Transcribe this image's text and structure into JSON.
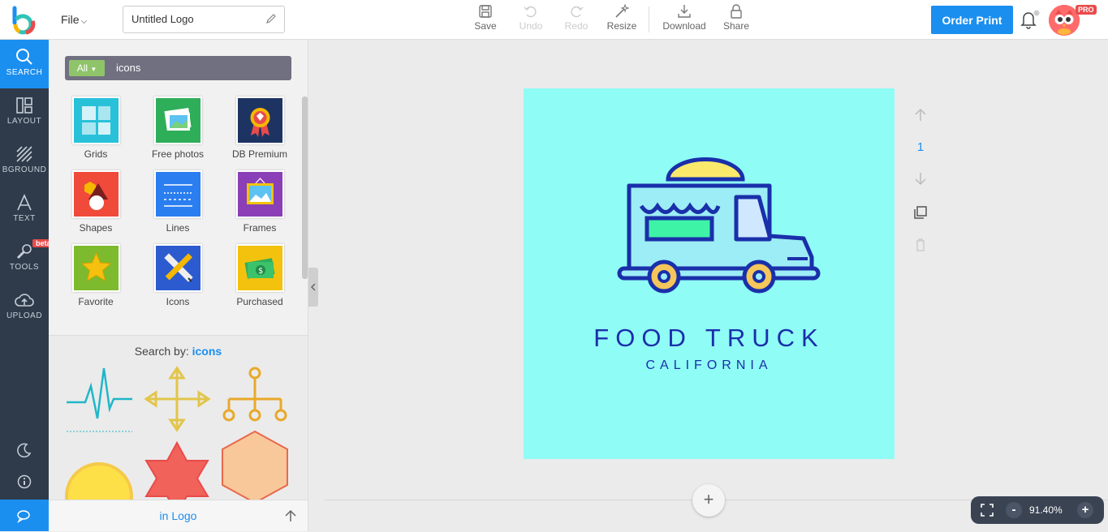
{
  "header": {
    "file_menu": "File",
    "document_title": "Untitled Logo",
    "tools": [
      {
        "label": "Save",
        "icon": "save-icon",
        "enabled": true
      },
      {
        "label": "Undo",
        "icon": "undo-icon",
        "enabled": false
      },
      {
        "label": "Redo",
        "icon": "redo-icon",
        "enabled": false
      },
      {
        "label": "Resize",
        "icon": "magic-wand-icon",
        "enabled": true
      },
      {
        "label": "Download",
        "icon": "download-icon",
        "enabled": true
      },
      {
        "label": "Share",
        "icon": "lock-icon",
        "enabled": true
      }
    ],
    "order_print": "Order Print",
    "pro_badge": "PRO"
  },
  "left_nav": {
    "items": [
      {
        "label": "SEARCH",
        "icon": "search-icon",
        "active": true
      },
      {
        "label": "LAYOUT",
        "icon": "layout-icon",
        "active": false
      },
      {
        "label": "BGROUND",
        "icon": "background-icon",
        "active": false
      },
      {
        "label": "TEXT",
        "icon": "text-icon",
        "active": false
      },
      {
        "label": "TOOLS",
        "icon": "wrench-icon",
        "active": false
      },
      {
        "label": "UPLOAD",
        "icon": "cloud-upload-icon",
        "active": false
      }
    ],
    "beta_label": "beta"
  },
  "panel": {
    "filter": "All",
    "search_value": "icons",
    "categories": [
      {
        "label": "Grids",
        "color": "#29c1d9"
      },
      {
        "label": "Free photos",
        "color": "#2fae5a"
      },
      {
        "label": "DB Premium",
        "color": "#1d3463"
      },
      {
        "label": "Shapes",
        "color": "#f04a3a"
      },
      {
        "label": "Lines",
        "color": "#2a7ef0"
      },
      {
        "label": "Frames",
        "color": "#8a3fb6"
      },
      {
        "label": "Favorite",
        "color": "#7eba2d"
      },
      {
        "label": "Icons",
        "color": "#2c5bd0"
      },
      {
        "label": "Purchased",
        "color": "#f2c20e"
      }
    ],
    "search_by_prefix": "Search by:",
    "search_by_term": "icons",
    "footer_label": "in Logo"
  },
  "canvas": {
    "background": "#8ffcf6",
    "title": "FOOD TRUCK",
    "subtitle": "CALIFORNIA",
    "page_number": "1"
  },
  "zoom": {
    "minus": "-",
    "value": "91.40%",
    "plus": "+"
  }
}
